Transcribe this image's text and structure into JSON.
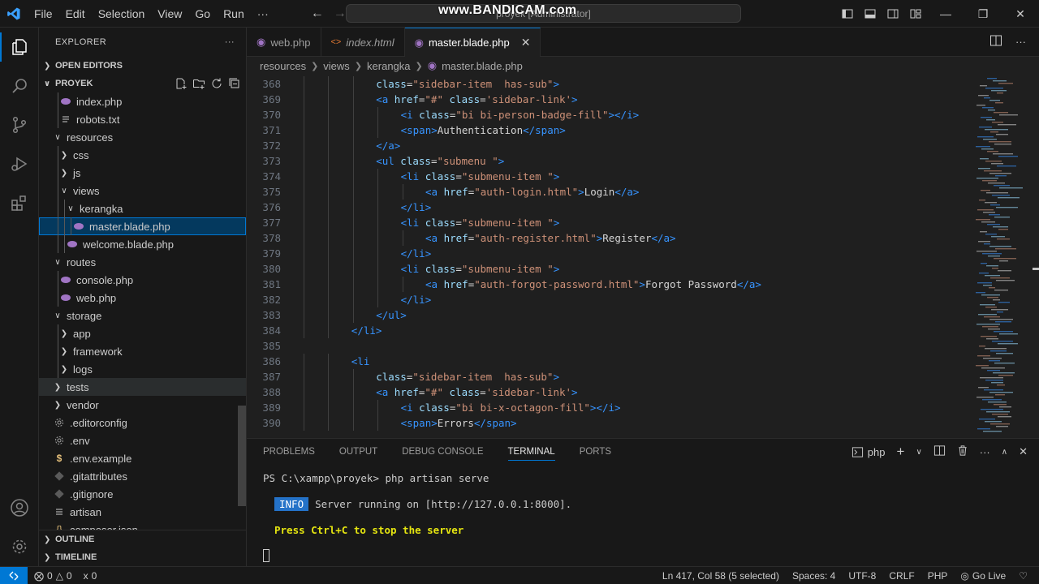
{
  "titlebar": {
    "menu": [
      "File",
      "Edit",
      "Selection",
      "View",
      "Go",
      "Run",
      "···"
    ],
    "search_text": "proyek [Administrator]",
    "watermark": "www.BANDICAM.com"
  },
  "sidebar": {
    "title": "EXPLORER",
    "more": "···",
    "open_editors": "OPEN EDITORS",
    "project": "PROYEK",
    "outline": "OUTLINE",
    "timeline": "TIMELINE",
    "tree": [
      {
        "label": "index.php",
        "icon": "php",
        "indent": 2,
        "type": "file"
      },
      {
        "label": "robots.txt",
        "icon": "txt",
        "indent": 2,
        "type": "file"
      },
      {
        "label": "resources",
        "indent": 1,
        "type": "folder-open"
      },
      {
        "label": "css",
        "indent": 2,
        "type": "folder"
      },
      {
        "label": "js",
        "indent": 2,
        "type": "folder"
      },
      {
        "label": "views",
        "indent": 2,
        "type": "folder-open"
      },
      {
        "label": "kerangka",
        "indent": 3,
        "type": "folder-open"
      },
      {
        "label": "master.blade.php",
        "icon": "php",
        "indent": 4,
        "type": "file",
        "selected": true
      },
      {
        "label": "welcome.blade.php",
        "icon": "php",
        "indent": 3,
        "type": "file"
      },
      {
        "label": "routes",
        "indent": 1,
        "type": "folder-open"
      },
      {
        "label": "console.php",
        "icon": "php",
        "indent": 2,
        "type": "file"
      },
      {
        "label": "web.php",
        "icon": "php",
        "indent": 2,
        "type": "file"
      },
      {
        "label": "storage",
        "indent": 1,
        "type": "folder-open"
      },
      {
        "label": "app",
        "indent": 2,
        "type": "folder"
      },
      {
        "label": "framework",
        "indent": 2,
        "type": "folder"
      },
      {
        "label": "logs",
        "indent": 2,
        "type": "folder"
      },
      {
        "label": "tests",
        "indent": 1,
        "type": "folder",
        "hover": true
      },
      {
        "label": "vendor",
        "indent": 1,
        "type": "folder"
      },
      {
        "label": ".editorconfig",
        "icon": "gear",
        "indent": 1,
        "type": "file"
      },
      {
        "label": ".env",
        "icon": "gear",
        "indent": 1,
        "type": "file"
      },
      {
        "label": ".env.example",
        "icon": "dollar",
        "indent": 1,
        "type": "file"
      },
      {
        "label": ".gitattributes",
        "icon": "git",
        "indent": 1,
        "type": "file"
      },
      {
        "label": ".gitignore",
        "icon": "git",
        "indent": 1,
        "type": "file"
      },
      {
        "label": "artisan",
        "icon": "lines",
        "indent": 1,
        "type": "file"
      },
      {
        "label": "composer.json",
        "icon": "json",
        "indent": 1,
        "type": "file"
      }
    ]
  },
  "tabs": [
    {
      "label": "web.php",
      "icon": "php",
      "active": false,
      "italic": false
    },
    {
      "label": "index.html",
      "icon": "html",
      "active": false,
      "italic": true
    },
    {
      "label": "master.blade.php",
      "icon": "php",
      "active": true,
      "italic": false
    }
  ],
  "breadcrumb": [
    "resources",
    "views",
    "kerangka",
    "master.blade.php"
  ],
  "code": [
    {
      "n": "368",
      "indent": 3,
      "t": [
        [
          "attr",
          "class"
        ],
        [
          "pl",
          "="
        ],
        [
          "str",
          "\"sidebar-item  has-sub\""
        ],
        [
          "tag",
          ">"
        ]
      ]
    },
    {
      "n": "369",
      "indent": 3,
      "t": [
        [
          "tag",
          "<a "
        ],
        [
          "attr",
          "href"
        ],
        [
          "pl",
          "="
        ],
        [
          "str",
          "\"#\""
        ],
        [
          "pl",
          " "
        ],
        [
          "attr",
          "class"
        ],
        [
          "pl",
          "="
        ],
        [
          "str",
          "'sidebar-link'"
        ],
        [
          "tag",
          ">"
        ]
      ]
    },
    {
      "n": "370",
      "indent": 4,
      "t": [
        [
          "tag",
          "<i "
        ],
        [
          "attr",
          "class"
        ],
        [
          "pl",
          "="
        ],
        [
          "str",
          "\"bi bi-person-badge-fill\""
        ],
        [
          "tag",
          "></i>"
        ]
      ]
    },
    {
      "n": "371",
      "indent": 4,
      "t": [
        [
          "tag",
          "<span>"
        ],
        [
          "pl",
          "Authentication"
        ],
        [
          "tag",
          "</span>"
        ]
      ]
    },
    {
      "n": "372",
      "indent": 3,
      "t": [
        [
          "tag",
          "</a>"
        ]
      ]
    },
    {
      "n": "373",
      "indent": 3,
      "t": [
        [
          "tag",
          "<ul "
        ],
        [
          "attr",
          "class"
        ],
        [
          "pl",
          "="
        ],
        [
          "str",
          "\"submenu \""
        ],
        [
          "tag",
          ">"
        ]
      ]
    },
    {
      "n": "374",
      "indent": 4,
      "t": [
        [
          "tag",
          "<li "
        ],
        [
          "attr",
          "class"
        ],
        [
          "pl",
          "="
        ],
        [
          "str",
          "\"submenu-item \""
        ],
        [
          "tag",
          ">"
        ]
      ]
    },
    {
      "n": "375",
      "indent": 5,
      "t": [
        [
          "tag",
          "<a "
        ],
        [
          "attr",
          "href"
        ],
        [
          "pl",
          "="
        ],
        [
          "str",
          "\"auth-login.html\""
        ],
        [
          "tag",
          ">"
        ],
        [
          "pl",
          "Login"
        ],
        [
          "tag",
          "</a>"
        ]
      ]
    },
    {
      "n": "376",
      "indent": 4,
      "t": [
        [
          "tag",
          "</li>"
        ]
      ]
    },
    {
      "n": "377",
      "indent": 4,
      "t": [
        [
          "tag",
          "<li "
        ],
        [
          "attr",
          "class"
        ],
        [
          "pl",
          "="
        ],
        [
          "str",
          "\"submenu-item \""
        ],
        [
          "tag",
          ">"
        ]
      ]
    },
    {
      "n": "378",
      "indent": 5,
      "t": [
        [
          "tag",
          "<a "
        ],
        [
          "attr",
          "href"
        ],
        [
          "pl",
          "="
        ],
        [
          "str",
          "\"auth-register.html\""
        ],
        [
          "tag",
          ">"
        ],
        [
          "pl",
          "Register"
        ],
        [
          "tag",
          "</a>"
        ]
      ]
    },
    {
      "n": "379",
      "indent": 4,
      "t": [
        [
          "tag",
          "</li>"
        ]
      ]
    },
    {
      "n": "380",
      "indent": 4,
      "t": [
        [
          "tag",
          "<li "
        ],
        [
          "attr",
          "class"
        ],
        [
          "pl",
          "="
        ],
        [
          "str",
          "\"submenu-item \""
        ],
        [
          "tag",
          ">"
        ]
      ]
    },
    {
      "n": "381",
      "indent": 5,
      "t": [
        [
          "tag",
          "<a "
        ],
        [
          "attr",
          "href"
        ],
        [
          "pl",
          "="
        ],
        [
          "str",
          "\"auth-forgot-password.html\""
        ],
        [
          "tag",
          ">"
        ],
        [
          "pl",
          "Forgot Password"
        ],
        [
          "tag",
          "</a>"
        ]
      ]
    },
    {
      "n": "382",
      "indent": 4,
      "t": [
        [
          "tag",
          "</li>"
        ]
      ]
    },
    {
      "n": "383",
      "indent": 3,
      "t": [
        [
          "tag",
          "</ul>"
        ]
      ]
    },
    {
      "n": "384",
      "indent": 2,
      "t": [
        [
          "tag",
          "</li>"
        ]
      ]
    },
    {
      "n": "385",
      "indent": 0,
      "t": []
    },
    {
      "n": "386",
      "indent": 2,
      "t": [
        [
          "tag",
          "<li"
        ]
      ]
    },
    {
      "n": "387",
      "indent": 3,
      "t": [
        [
          "attr",
          "class"
        ],
        [
          "pl",
          "="
        ],
        [
          "str",
          "\"sidebar-item  has-sub\""
        ],
        [
          "tag",
          ">"
        ]
      ]
    },
    {
      "n": "388",
      "indent": 3,
      "t": [
        [
          "tag",
          "<a "
        ],
        [
          "attr",
          "href"
        ],
        [
          "pl",
          "="
        ],
        [
          "str",
          "\"#\""
        ],
        [
          "pl",
          " "
        ],
        [
          "attr",
          "class"
        ],
        [
          "pl",
          "="
        ],
        [
          "str",
          "'sidebar-link'"
        ],
        [
          "tag",
          ">"
        ]
      ]
    },
    {
      "n": "389",
      "indent": 4,
      "t": [
        [
          "tag",
          "<i "
        ],
        [
          "attr",
          "class"
        ],
        [
          "pl",
          "="
        ],
        [
          "str",
          "\"bi bi-x-octagon-fill\""
        ],
        [
          "tag",
          "></i>"
        ]
      ]
    },
    {
      "n": "390",
      "indent": 4,
      "t": [
        [
          "tag",
          "<span>"
        ],
        [
          "pl",
          "Errors"
        ],
        [
          "tag",
          "</span>"
        ]
      ]
    }
  ],
  "panel": {
    "tabs": [
      "PROBLEMS",
      "OUTPUT",
      "DEBUG CONSOLE",
      "TERMINAL",
      "PORTS"
    ],
    "active_tab": "TERMINAL",
    "shell": "php",
    "prompt": "PS C:\\xampp\\proyek> php artisan serve",
    "info_badge": "INFO",
    "info_text": "Server running on [http://127.0.0.1:8000].",
    "stop_text": "Press Ctrl+C to stop the server"
  },
  "statusbar": {
    "errors": "0",
    "warnings": "0",
    "ports": "0",
    "position": "Ln 417, Col 58 (5 selected)",
    "spaces": "Spaces: 4",
    "encoding": "UTF-8",
    "eol": "CRLF",
    "language": "PHP",
    "golive": "Go Live"
  },
  "colors": {
    "accent": "#0078d4",
    "tag": "#3794ff",
    "attr": "#9cdcfe",
    "string": "#ce9178",
    "php_icon": "#a074c4"
  }
}
